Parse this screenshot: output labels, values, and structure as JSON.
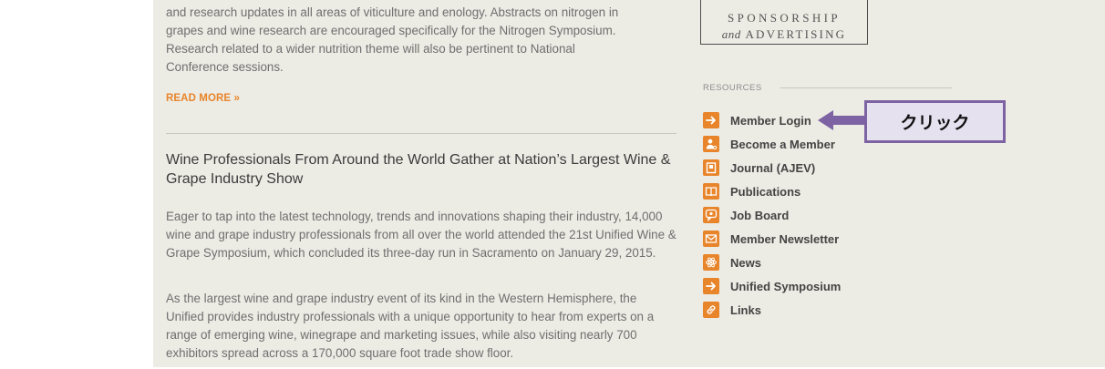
{
  "article1": {
    "intro_lines": [
      "and research updates in all areas of viticulture and enology. Abstracts on nitrogen in",
      "grapes and wine research are encouraged specifically for the Nitrogen Symposium.",
      "Research related to a wider nutrition theme will also be pertinent to National",
      "Conference sessions."
    ],
    "read_more": "READ MORE »"
  },
  "article2": {
    "title": "Wine Professionals From Around the World Gather at Nation’s Largest Wine & Grape Industry Show",
    "paragraphs": [
      "Eager to tap into the latest technology, trends and innovations shaping their industry, 14,000 wine and grape industry professionals from all over the world attended the 21st Unified Wine & Grape Symposium, which concluded its three-day run in Sacramento on January 29, 2015.",
      "As the largest wine and grape industry event of its kind in the Western Hemisphere, the Unified provides industry professionals with a unique opportunity to hear from experts on a range of emerging wine, winegrape and marketing issues, while also visiting nearly 700 exhibitors spread across a 170,000 square foot trade show floor."
    ]
  },
  "sponsorship": {
    "line1": "SPONSORSHIP",
    "line2_and": "and",
    "line2_rest": "ADVERTISING"
  },
  "resources": {
    "heading": "RESOURCES",
    "items": [
      {
        "label": "Member Login",
        "icon": "arrow-right-icon"
      },
      {
        "label": "Become a Member",
        "icon": "person-icon"
      },
      {
        "label": "Journal (AJEV)",
        "icon": "journal-icon"
      },
      {
        "label": "Publications",
        "icon": "book-icon"
      },
      {
        "label": "Job Board",
        "icon": "chat-icon"
      },
      {
        "label": "Member Newsletter",
        "icon": "envelope-icon"
      },
      {
        "label": "News",
        "icon": "atom-icon"
      },
      {
        "label": "Unified Symposium",
        "icon": "arrow-right-icon"
      },
      {
        "label": "Links",
        "icon": "link-icon"
      }
    ]
  },
  "callout": {
    "text": "クリック"
  },
  "colors": {
    "accent_orange": "#e8852b",
    "callout_purple": "#7d63a3",
    "callout_fill": "#e5e1ef",
    "panel_bg": "#ecebe4"
  }
}
